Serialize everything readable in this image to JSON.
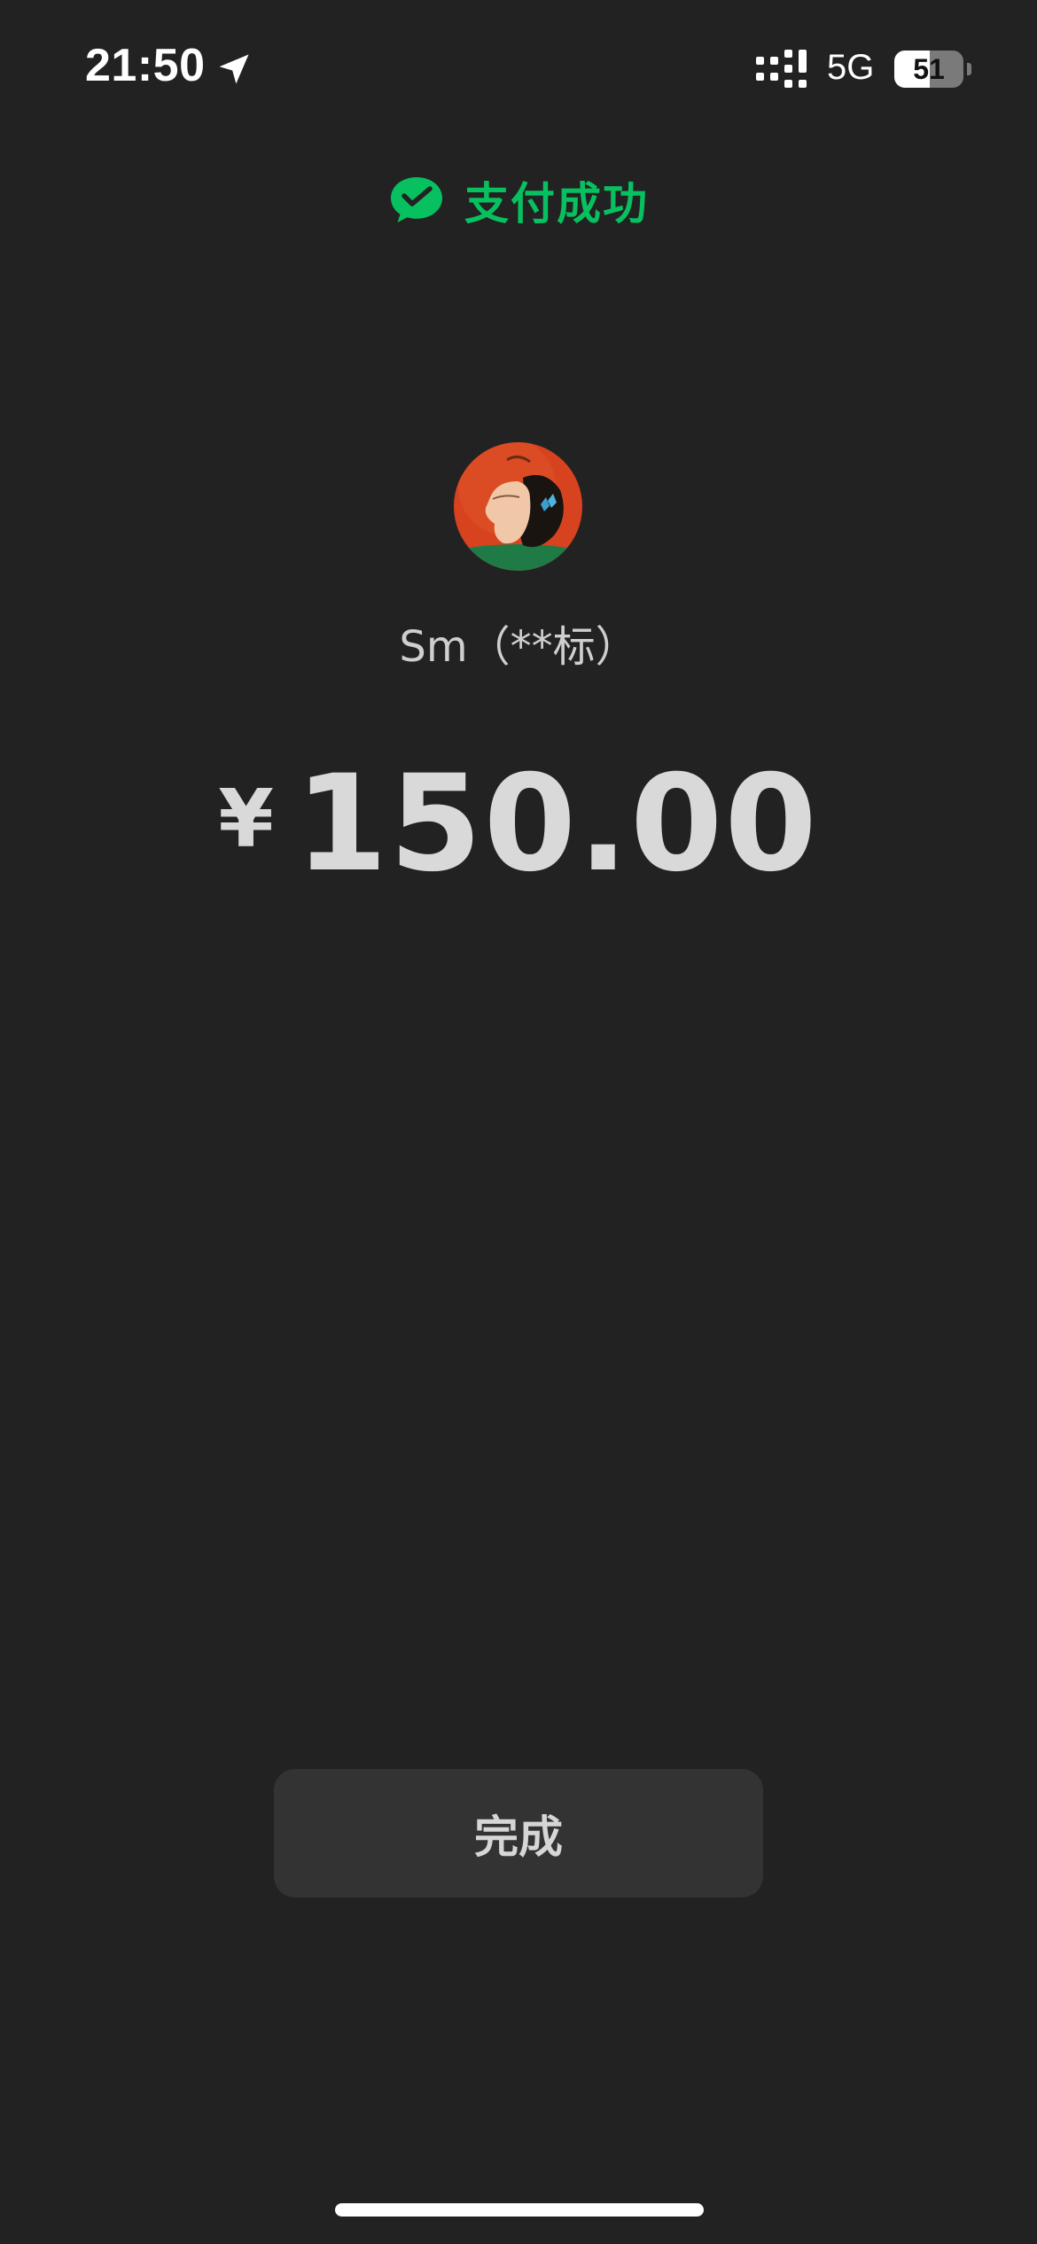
{
  "status_bar": {
    "time": "21:50",
    "network": "5G",
    "battery_level": "51",
    "battery_fraction": 0.51,
    "location_icon": "location-arrow-icon",
    "signal_icon": "cellular-signal-icon"
  },
  "header": {
    "icon": "wechat-pay-icon",
    "title": "支付成功",
    "accent_color": "#07c160"
  },
  "payee": {
    "name": "Sm（**标）",
    "avatar": "payee-avatar"
  },
  "payment": {
    "currency_symbol": "¥",
    "amount": "150.00"
  },
  "actions": {
    "done_label": "完成"
  },
  "colors": {
    "background": "#222222",
    "button": "#333333",
    "text": "#d9d9d9"
  }
}
